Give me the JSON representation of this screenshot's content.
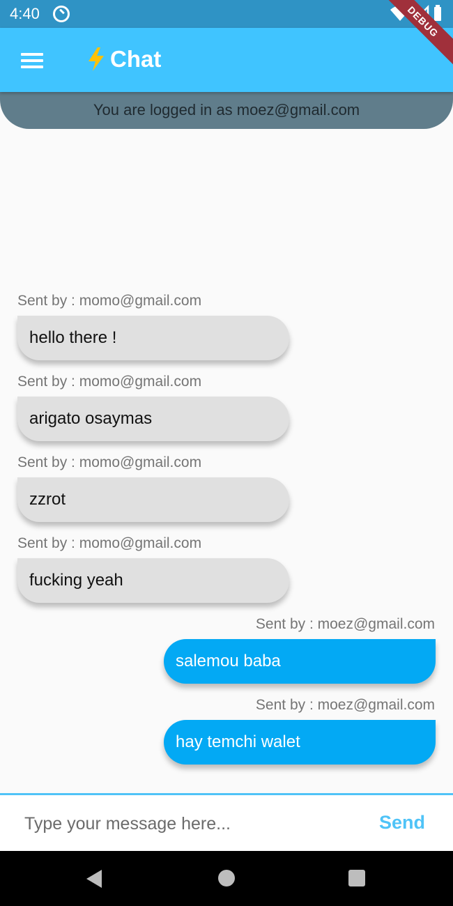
{
  "status_bar": {
    "time": "4:40",
    "icons": [
      "sync-icon",
      "wifi-icon",
      "signal-icon",
      "battery-icon"
    ]
  },
  "debug_banner": "DEBUG",
  "app_bar": {
    "title": "Chat",
    "title_icon": "lightning-bolt-icon",
    "menu_icon": "hamburger-menu-icon",
    "color": "#40c4ff"
  },
  "login_banner": "You are logged in as moez@gmail.com",
  "messages": [
    {
      "sender": "Sent by : momo@gmail.com",
      "text": "hello there !",
      "side": "left"
    },
    {
      "sender": "Sent by : momo@gmail.com",
      "text": "arigato osaymas",
      "side": "left"
    },
    {
      "sender": "Sent by : momo@gmail.com",
      "text": "zzrot",
      "side": "left"
    },
    {
      "sender": "Sent by : momo@gmail.com",
      "text": "fucking yeah",
      "side": "left"
    },
    {
      "sender": "Sent by : moez@gmail.com",
      "text": "salemou baba",
      "side": "right"
    },
    {
      "sender": "Sent by : moez@gmail.com",
      "text": "hay temchi walet",
      "side": "right"
    }
  ],
  "composer": {
    "placeholder": "Type your message here...",
    "value": "",
    "send_label": "Send"
  },
  "colors": {
    "sent_bubble": "#03a9f4",
    "received_bubble": "#e0e0e0",
    "accent": "#4fc3f7",
    "banner": "#607d8b"
  },
  "nav_bar": {
    "icons": [
      "back-icon",
      "home-icon",
      "recents-icon"
    ]
  }
}
